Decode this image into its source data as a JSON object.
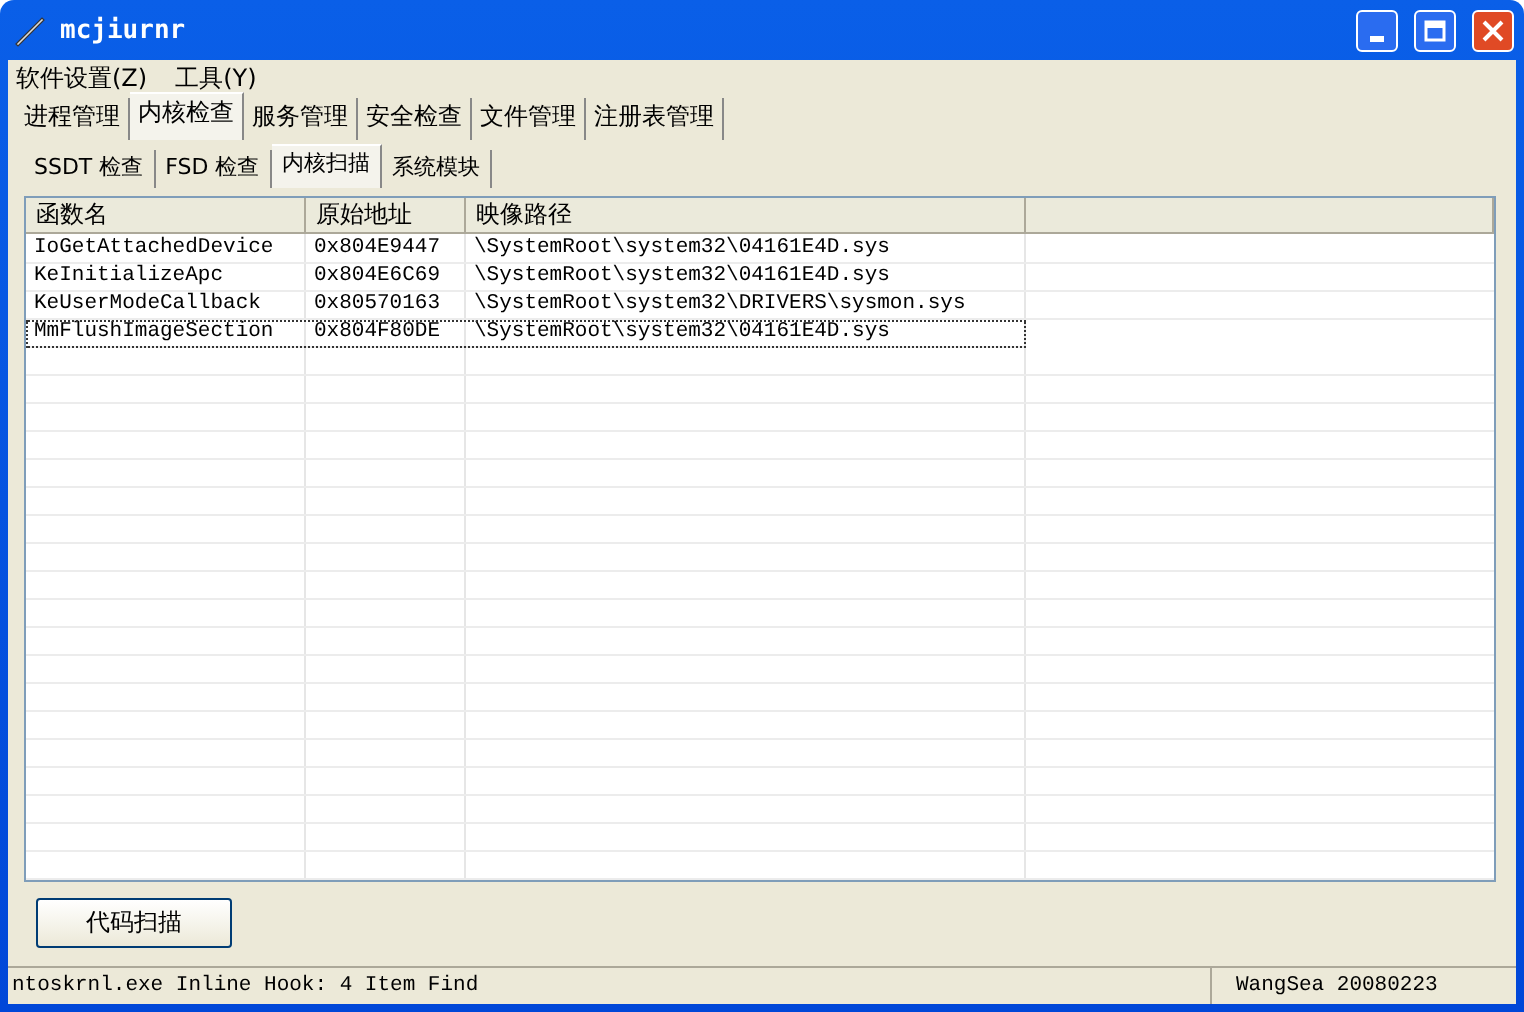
{
  "window": {
    "title": "mcjiurnr"
  },
  "menu": [
    "软件设置(Z)",
    "工具(Y)"
  ],
  "tabs": [
    {
      "label": "进程管理",
      "selected": false
    },
    {
      "label": "内核检查",
      "selected": true
    },
    {
      "label": "服务管理",
      "selected": false
    },
    {
      "label": "安全检查",
      "selected": false
    },
    {
      "label": "文件管理",
      "selected": false
    },
    {
      "label": "注册表管理",
      "selected": false
    }
  ],
  "subtabs": [
    {
      "label": "SSDT 检查",
      "selected": false
    },
    {
      "label": "FSD 检查",
      "selected": false
    },
    {
      "label": "内核扫描",
      "selected": true
    },
    {
      "label": "系统模块",
      "selected": false
    }
  ],
  "table": {
    "columns": [
      "函数名",
      "原始地址",
      "映像路径"
    ],
    "rows": [
      {
        "cells": [
          "IoGetAttachedDevice",
          "0x804E9447",
          "\\SystemRoot\\system32\\04161E4D.sys"
        ],
        "selected": false
      },
      {
        "cells": [
          "KeInitializeApc",
          "0x804E6C69",
          "\\SystemRoot\\system32\\04161E4D.sys"
        ],
        "selected": false
      },
      {
        "cells": [
          "KeUserModeCallback",
          "0x80570163",
          "\\SystemRoot\\system32\\DRIVERS\\sysmon.sys"
        ],
        "selected": false
      },
      {
        "cells": [
          "MmFlushImageSection",
          "0x804F80DE",
          "\\SystemRoot\\system32\\04161E4D.sys"
        ],
        "selected": true
      }
    ]
  },
  "scan_button": "代码扫描",
  "status_bar": [
    "ntoskrnl.exe Inline Hook: 4 Item Find",
    "WangSea 20080223"
  ]
}
